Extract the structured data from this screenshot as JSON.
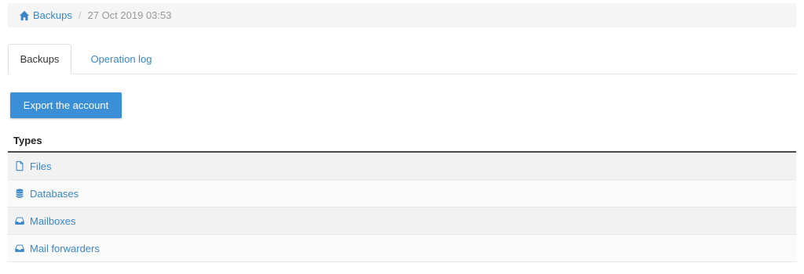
{
  "breadcrumb": {
    "home_label": "Backups",
    "current": "27 Oct 2019 03:53"
  },
  "tabs": [
    {
      "label": "Backups",
      "active": true
    },
    {
      "label": "Operation log",
      "active": false
    }
  ],
  "actions": {
    "export_label": "Export the account"
  },
  "table": {
    "header": "Types",
    "rows": [
      {
        "label": "Files",
        "icon": "file-icon"
      },
      {
        "label": "Databases",
        "icon": "database-icon"
      },
      {
        "label": "Mailboxes",
        "icon": "inbox-icon"
      },
      {
        "label": "Mail forwarders",
        "icon": "inbox-icon"
      }
    ]
  },
  "colors": {
    "accent": "#3b8fd6",
    "link": "#3a87c8"
  }
}
